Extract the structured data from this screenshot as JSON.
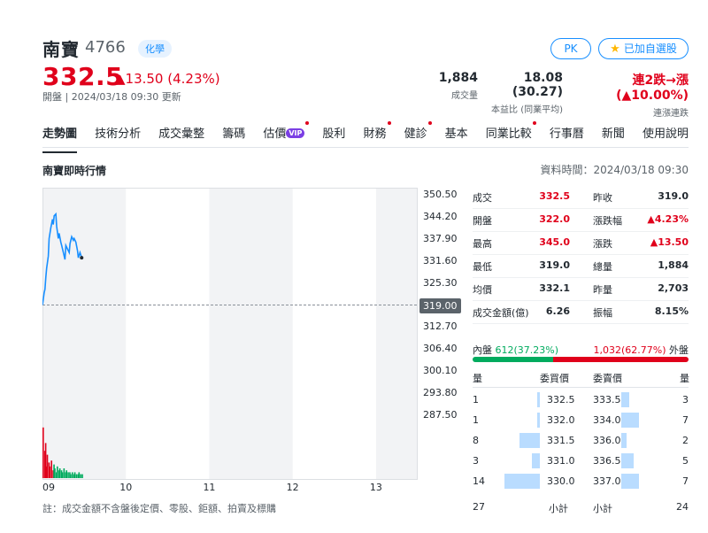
{
  "stock": {
    "name": "南寶",
    "code": "4766",
    "tag": "化學"
  },
  "price": {
    "last": "332.5",
    "change": "▲13.50 (4.23%)",
    "status": "開盤 | 2024/03/18 09:30 更新"
  },
  "buttons": {
    "pk": "PK",
    "watch": "已加自選股"
  },
  "stats": [
    {
      "value": "1,884",
      "label": "成交量"
    },
    {
      "value": "18.08 (30.27)",
      "label": "本益比 (同業平均)"
    },
    {
      "value": "連2跌→漲 (▲10.00%)",
      "label": "連漲連跌"
    }
  ],
  "tabs": [
    {
      "label": "走勢圖",
      "active": true,
      "dot": false
    },
    {
      "label": "技術分析",
      "dot": false
    },
    {
      "label": "成交彙整",
      "dot": false
    },
    {
      "label": "籌碼",
      "dot": false
    },
    {
      "label": "估價",
      "vip": "VIP",
      "dot": true
    },
    {
      "label": "股利",
      "dot": false
    },
    {
      "label": "財務",
      "dot": true
    },
    {
      "label": "健診",
      "dot": true
    },
    {
      "label": "基本",
      "dot": false
    },
    {
      "label": "同業比較",
      "dot": true
    },
    {
      "label": "行事曆",
      "dot": false
    },
    {
      "label": "新聞",
      "dot": false
    },
    {
      "label": "使用說明",
      "dot": false
    }
  ],
  "section": {
    "title": "南寶即時行情",
    "datatime": "資料時間：2024/03/18 09:30"
  },
  "chart_data": {
    "type": "line",
    "y_ticks": [
      "350.50",
      "344.20",
      "337.90",
      "331.60",
      "325.30",
      "319.00",
      "312.70",
      "306.40",
      "300.10",
      "293.80",
      "287.50"
    ],
    "current_label": "319.00",
    "reference_price": 319.0,
    "ylim": [
      287.5,
      350.5
    ],
    "x_ticks": [
      "09",
      "10",
      "11",
      "12",
      "13"
    ],
    "x_range_hours": [
      9,
      13.5
    ],
    "price_series": [
      [
        9.0,
        319.0
      ],
      [
        9.02,
        322.5
      ],
      [
        9.03,
        323.5
      ],
      [
        9.04,
        327.0
      ],
      [
        9.05,
        329.5
      ],
      [
        9.07,
        333.0
      ],
      [
        9.08,
        338.0
      ],
      [
        9.1,
        341.0
      ],
      [
        9.12,
        343.5
      ],
      [
        9.13,
        342.0
      ],
      [
        9.14,
        344.5
      ],
      [
        9.16,
        345.0
      ],
      [
        9.17,
        341.5
      ],
      [
        9.19,
        338.0
      ],
      [
        9.2,
        339.5
      ],
      [
        9.22,
        337.0
      ],
      [
        9.23,
        336.0
      ],
      [
        9.25,
        334.0
      ],
      [
        9.27,
        332.0
      ],
      [
        9.28,
        336.0
      ],
      [
        9.3,
        335.0
      ],
      [
        9.32,
        334.0
      ],
      [
        9.33,
        336.5
      ],
      [
        9.35,
        338.5
      ],
      [
        9.37,
        337.5
      ],
      [
        9.38,
        338.0
      ],
      [
        9.4,
        337.0
      ],
      [
        9.42,
        334.5
      ],
      [
        9.43,
        332.5
      ],
      [
        9.45,
        334.0
      ],
      [
        9.47,
        332.5
      ]
    ],
    "volume_series": [
      26,
      14,
      18,
      6,
      12,
      8,
      6,
      9,
      4,
      7,
      5,
      3,
      6,
      4,
      5,
      4,
      3,
      5,
      3,
      4,
      3,
      3,
      2,
      3,
      2,
      3,
      2,
      2,
      3,
      2,
      2
    ],
    "volume_max": 30
  },
  "note": "註：成交金額不含盤後定價、零股、鉅額、拍賣及標購",
  "quote": [
    {
      "l1": "成交",
      "v1": "332.5",
      "c1": "red",
      "l2": "昨收",
      "v2": "319.0",
      "c2": ""
    },
    {
      "l1": "開盤",
      "v1": "322.0",
      "c1": "red",
      "l2": "漲跌幅",
      "v2": "▲4.23%",
      "c2": "red"
    },
    {
      "l1": "最高",
      "v1": "345.0",
      "c1": "red",
      "l2": "漲跌",
      "v2": "▲13.50",
      "c2": "red"
    },
    {
      "l1": "最低",
      "v1": "319.0",
      "c1": "",
      "l2": "總量",
      "v2": "1,884",
      "c2": ""
    },
    {
      "l1": "均價",
      "v1": "332.1",
      "c1": "",
      "l2": "昨量",
      "v2": "2,703",
      "c2": ""
    },
    {
      "l1": "成交金額(億)",
      "v1": "6.26",
      "c1": "",
      "l2": "振幅",
      "v2": "8.15%",
      "c2": ""
    }
  ],
  "inout": {
    "in_label": "內盤",
    "in_value": "612(37.23%)",
    "out_value": "1,032(62.77%)",
    "out_label": "外盤",
    "in_pct": 37.23
  },
  "book": {
    "headers": {
      "bid_vol": "量",
      "bid_price": "委買價",
      "ask_price": "委賣價",
      "ask_vol": "量"
    },
    "rows": [
      {
        "bv": "1",
        "bp": "332.5",
        "bw": 1,
        "ap": "333.5",
        "av": "3",
        "aw": 3
      },
      {
        "bv": "1",
        "bp": "332.0",
        "bw": 1,
        "ap": "334.0",
        "av": "7",
        "aw": 7
      },
      {
        "bv": "8",
        "bp": "331.5",
        "bw": 8,
        "ap": "336.0",
        "av": "2",
        "aw": 2
      },
      {
        "bv": "3",
        "bp": "331.0",
        "bw": 3,
        "ap": "336.5",
        "av": "5",
        "aw": 5
      },
      {
        "bv": "14",
        "bp": "330.0",
        "bw": 14,
        "ap": "337.0",
        "av": "7",
        "aw": 7
      }
    ],
    "totals": {
      "bid": "27",
      "bid_label": "小計",
      "ask_label": "小計",
      "ask": "24"
    }
  }
}
